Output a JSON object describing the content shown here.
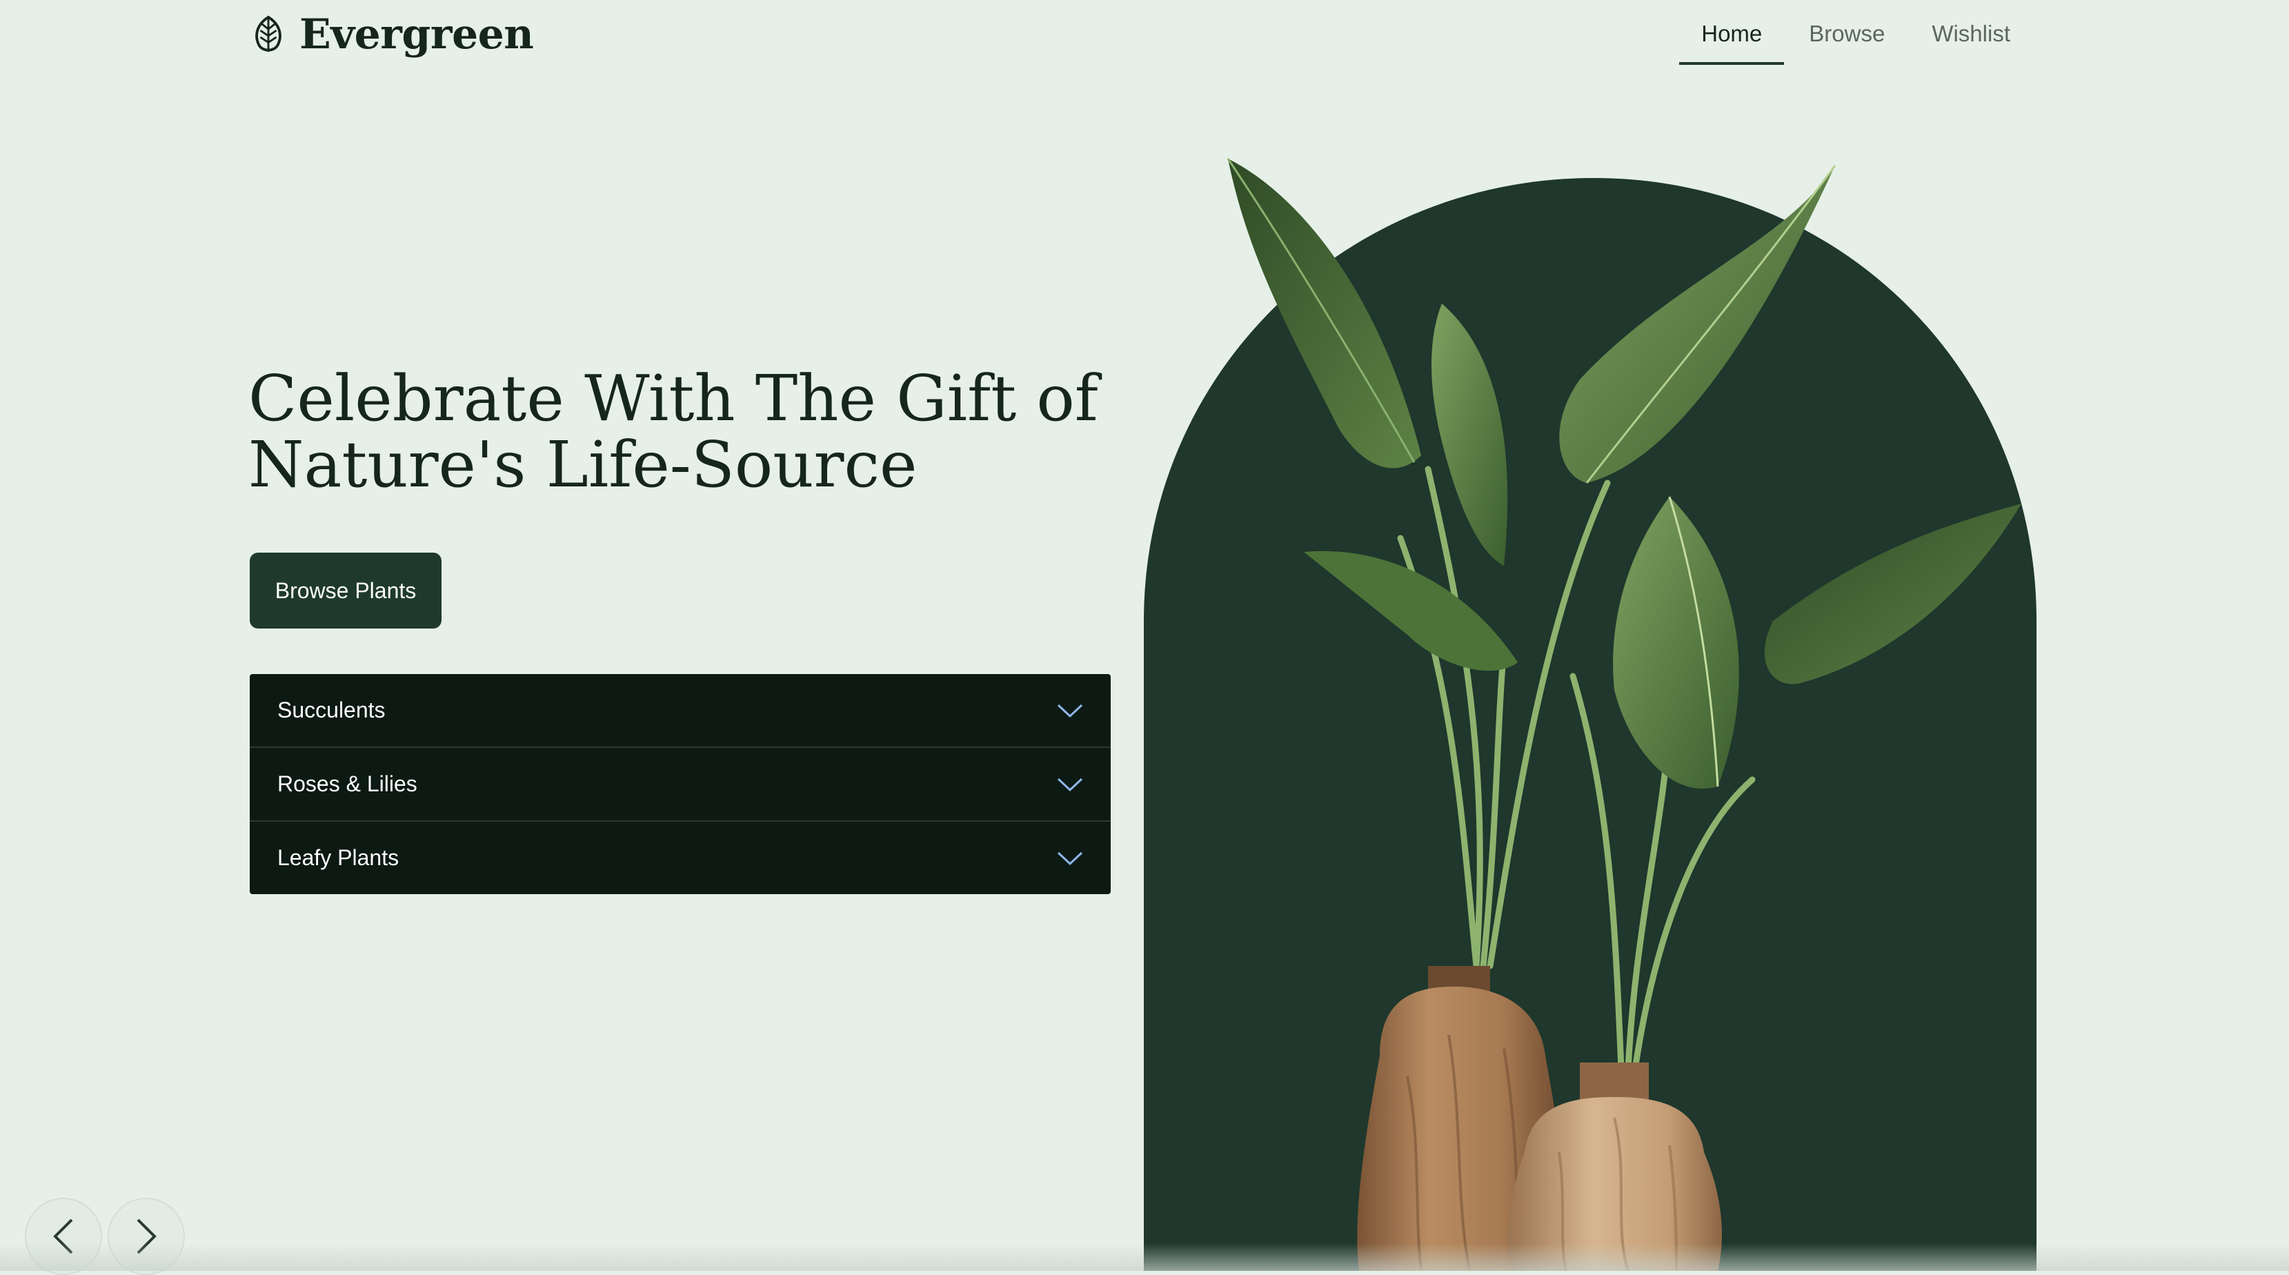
{
  "brand": {
    "name": "Evergreen",
    "icon": "leaf-icon"
  },
  "nav": {
    "items": [
      {
        "label": "Home",
        "active": true
      },
      {
        "label": "Browse",
        "active": false
      },
      {
        "label": "Wishlist",
        "active": false
      }
    ]
  },
  "hero": {
    "headline_line1": "Celebrate With The Gift of",
    "headline_line2": "Nature's Life-Source",
    "cta_label": "Browse Plants"
  },
  "categories": [
    {
      "label": "Succulents",
      "icon": "chevron-down-icon"
    },
    {
      "label": "Roses & Lilies",
      "icon": "chevron-down-icon"
    },
    {
      "label": "Leafy Plants",
      "icon": "chevron-down-icon"
    }
  ],
  "carousel": {
    "prev_icon": "chevron-left-icon",
    "next_icon": "chevron-right-icon"
  },
  "colors": {
    "background": "#e6f0e8",
    "primary_dark": "#1f3a2d",
    "accordion_bg": "#0c1a13",
    "arch": "#1f372c",
    "chevron": "#8fb6e8"
  }
}
